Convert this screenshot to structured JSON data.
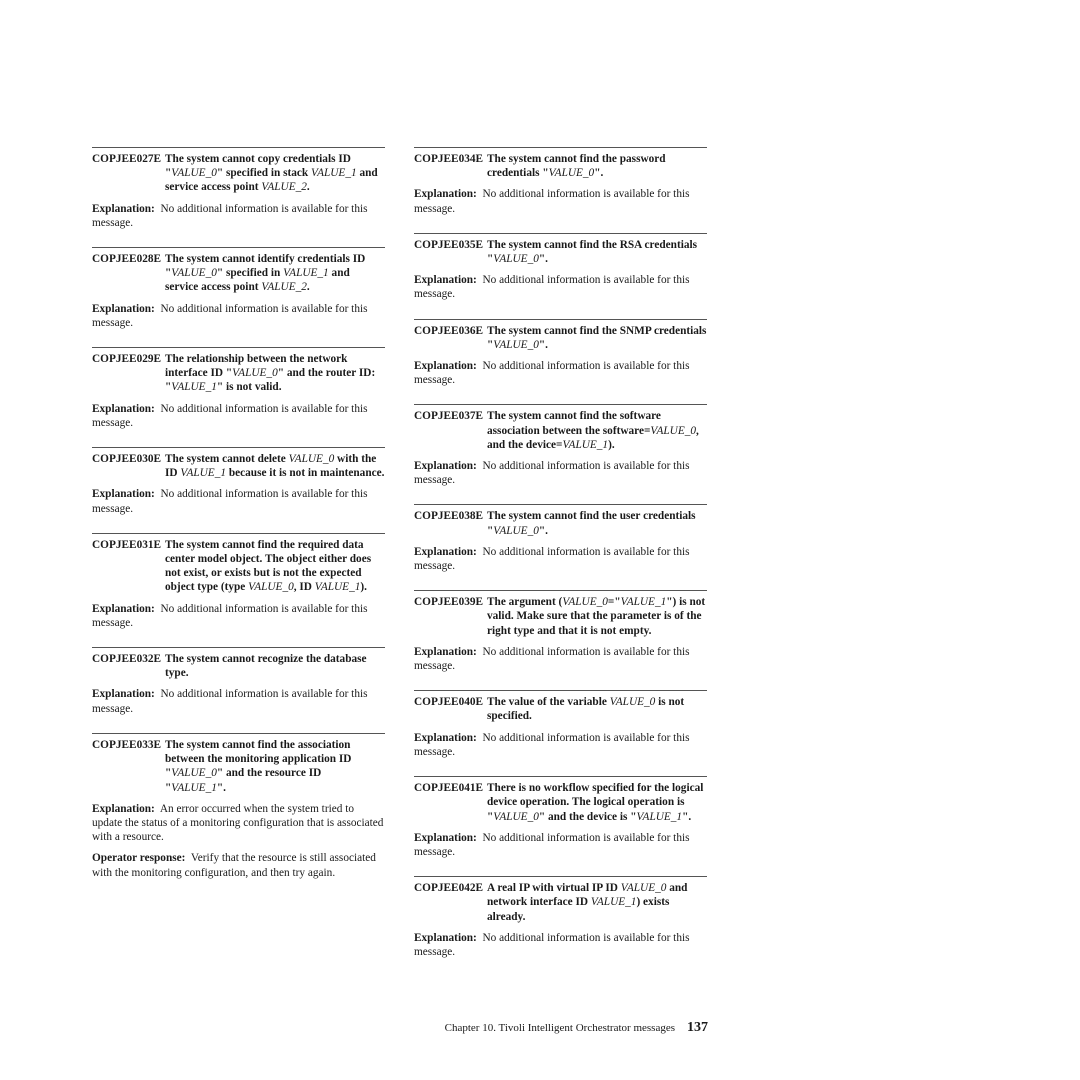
{
  "left_column": [
    {
      "code": "COPJEE027E",
      "parts": [
        [
          "The system cannot copy credentials ID \"",
          0
        ],
        [
          "VALUE_0",
          1
        ],
        [
          "\" specified in stack ",
          0
        ],
        [
          "VALUE_1",
          1
        ],
        [
          " and service access point ",
          0
        ],
        [
          "VALUE_2",
          1
        ],
        [
          ".",
          0
        ]
      ],
      "sections": [
        {
          "label": "Explanation:",
          "text": "No additional information is available for this message."
        }
      ]
    },
    {
      "code": "COPJEE028E",
      "parts": [
        [
          "The system cannot identify credentials ID \"",
          0
        ],
        [
          "VALUE_0",
          1
        ],
        [
          "\" specified in ",
          0
        ],
        [
          "VALUE_1",
          1
        ],
        [
          " and service access point ",
          0
        ],
        [
          "VALUE_2",
          1
        ],
        [
          ".",
          0
        ]
      ],
      "sections": [
        {
          "label": "Explanation:",
          "text": "No additional information is available for this message."
        }
      ]
    },
    {
      "code": "COPJEE029E",
      "parts": [
        [
          "The relationship between the network interface ID \"",
          0
        ],
        [
          "VALUE_0",
          1
        ],
        [
          "\" and the router ID: \"",
          0
        ],
        [
          "VALUE_1",
          1
        ],
        [
          "\" is not valid.",
          0
        ]
      ],
      "sections": [
        {
          "label": "Explanation:",
          "text": "No additional information is available for this message."
        }
      ]
    },
    {
      "code": "COPJEE030E",
      "parts": [
        [
          "The system cannot delete ",
          0
        ],
        [
          "VALUE_0",
          1
        ],
        [
          " with the ID ",
          0
        ],
        [
          "VALUE_1",
          1
        ],
        [
          " because it is not in maintenance.",
          0
        ]
      ],
      "sections": [
        {
          "label": "Explanation:",
          "text": "No additional information is available for this message."
        }
      ]
    },
    {
      "code": "COPJEE031E",
      "parts": [
        [
          "The system cannot find the required data center model object. The object either does not exist, or exists but is not the expected object type (type ",
          0
        ],
        [
          "VALUE_0",
          1
        ],
        [
          ", ID ",
          0
        ],
        [
          "VALUE_1",
          1
        ],
        [
          ").",
          0
        ]
      ],
      "sections": [
        {
          "label": "Explanation:",
          "text": "No additional information is available for this message."
        }
      ]
    },
    {
      "code": "COPJEE032E",
      "parts": [
        [
          "The system cannot recognize the database type.",
          0
        ]
      ],
      "sections": [
        {
          "label": "Explanation:",
          "text": "No additional information is available for this message."
        }
      ]
    },
    {
      "code": "COPJEE033E",
      "parts": [
        [
          "The system cannot find the association between the monitoring application ID \"",
          0
        ],
        [
          "VALUE_0",
          1
        ],
        [
          "\" and the resource ID \"",
          0
        ],
        [
          "VALUE_1",
          1
        ],
        [
          "\".",
          0
        ]
      ],
      "sections": [
        {
          "label": "Explanation:",
          "text": "An error occurred when the system tried to update the status of a monitoring configuration that is associated with a resource."
        },
        {
          "label": "Operator response:",
          "text": "Verify that the resource is still associated with the monitoring configuration, and then try again."
        }
      ]
    }
  ],
  "right_column": [
    {
      "code": "COPJEE034E",
      "parts": [
        [
          "The system cannot find the password credentials \"",
          0
        ],
        [
          "VALUE_0",
          1
        ],
        [
          "\".",
          0
        ]
      ],
      "sections": [
        {
          "label": "Explanation:",
          "text": "No additional information is available for this message."
        }
      ]
    },
    {
      "code": "COPJEE035E",
      "parts": [
        [
          "The system cannot find the RSA credentials \"",
          0
        ],
        [
          "VALUE_0",
          1
        ],
        [
          "\".",
          0
        ]
      ],
      "sections": [
        {
          "label": "Explanation:",
          "text": "No additional information is available for this message."
        }
      ]
    },
    {
      "code": "COPJEE036E",
      "parts": [
        [
          "The system cannot find the SNMP credentials \"",
          0
        ],
        [
          "VALUE_0",
          1
        ],
        [
          "\".",
          0
        ]
      ],
      "sections": [
        {
          "label": "Explanation:",
          "text": "No additional information is available for this message."
        }
      ]
    },
    {
      "code": "COPJEE037E",
      "parts": [
        [
          "The system cannot find the software association between the software=",
          0
        ],
        [
          "VALUE_0",
          1
        ],
        [
          ", and the device=",
          0
        ],
        [
          "VALUE_1",
          1
        ],
        [
          ").",
          0
        ]
      ],
      "sections": [
        {
          "label": "Explanation:",
          "text": "No additional information is available for this message."
        }
      ]
    },
    {
      "code": "COPJEE038E",
      "parts": [
        [
          "The system cannot find the user credentials \"",
          0
        ],
        [
          "VALUE_0",
          1
        ],
        [
          "\".",
          0
        ]
      ],
      "sections": [
        {
          "label": "Explanation:",
          "text": "No additional information is available for this message."
        }
      ]
    },
    {
      "code": "COPJEE039E",
      "parts": [
        [
          "The argument (",
          0
        ],
        [
          "VALUE_0",
          1
        ],
        [
          "=\"",
          0
        ],
        [
          "VALUE_1",
          1
        ],
        [
          "\") is not valid. Make sure that the parameter is of the right type and that it is not empty.",
          0
        ]
      ],
      "sections": [
        {
          "label": "Explanation:",
          "text": "No additional information is available for this message."
        }
      ]
    },
    {
      "code": "COPJEE040E",
      "parts": [
        [
          "The value of the variable ",
          0
        ],
        [
          "VALUE_0",
          1
        ],
        [
          " is not specified.",
          0
        ]
      ],
      "sections": [
        {
          "label": "Explanation:",
          "text": "No additional information is available for this message."
        }
      ]
    },
    {
      "code": "COPJEE041E",
      "parts": [
        [
          "There is no workflow specified for the logical device operation. The logical operation is \"",
          0
        ],
        [
          "VALUE_0",
          1
        ],
        [
          "\" and the device is \"",
          0
        ],
        [
          "VALUE_1",
          1
        ],
        [
          "\".",
          0
        ]
      ],
      "sections": [
        {
          "label": "Explanation:",
          "text": "No additional information is available for this message."
        }
      ]
    },
    {
      "code": "COPJEE042E",
      "parts": [
        [
          "A real IP with virtual IP ID ",
          0
        ],
        [
          "VALUE_0",
          1
        ],
        [
          " and network interface ID ",
          0
        ],
        [
          "VALUE_1",
          1
        ],
        [
          ") exists already.",
          0
        ]
      ],
      "sections": [
        {
          "label": "Explanation:",
          "text": "No additional information is available for this message."
        }
      ]
    }
  ],
  "footer": {
    "chapter": "Chapter 10. Tivoli Intelligent Orchestrator messages",
    "page": "137"
  }
}
